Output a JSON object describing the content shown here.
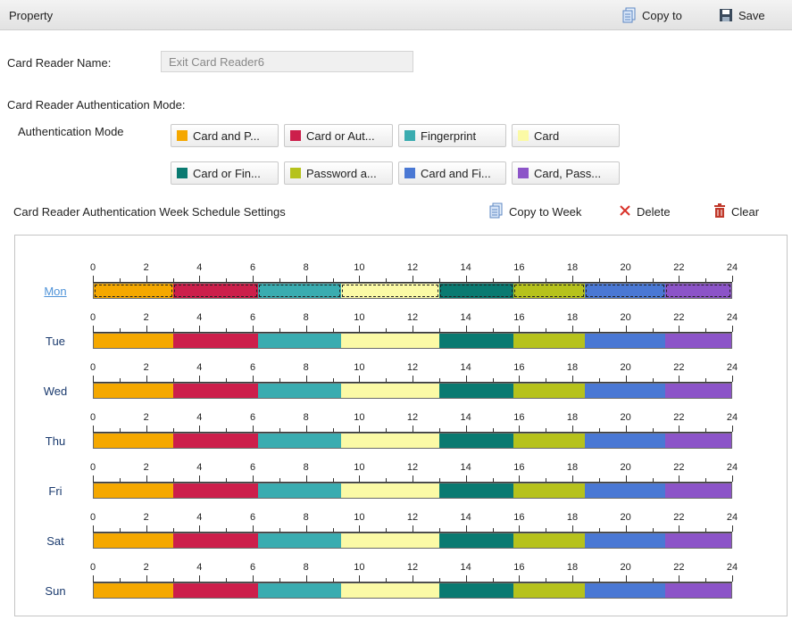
{
  "header": {
    "title": "Property",
    "copy_to_label": "Copy to",
    "save_label": "Save"
  },
  "card_reader_name": {
    "label": "Card Reader Name:",
    "value": "Exit Card Reader6"
  },
  "auth_mode_section": {
    "title": "Card Reader Authentication Mode:",
    "mode_label": "Authentication Mode"
  },
  "modes": [
    {
      "label": "Card and P...",
      "color": "#f5a800"
    },
    {
      "label": "Card or Aut...",
      "color": "#cc1f4b"
    },
    {
      "label": "Fingerprint",
      "color": "#3aacb0"
    },
    {
      "label": "Card",
      "color": "#fbfaa6"
    },
    {
      "label": "Card or Fin...",
      "color": "#0a7a71"
    },
    {
      "label": "Password a...",
      "color": "#b6c21c"
    },
    {
      "label": "Card and Fi...",
      "color": "#4a78d4"
    },
    {
      "label": "Card, Pass...",
      "color": "#8c54c8"
    }
  ],
  "schedule": {
    "title": "Card Reader Authentication Week Schedule Settings",
    "copy_to_week_label": "Copy to Week",
    "delete_label": "Delete",
    "clear_label": "Clear",
    "hours": [
      "0",
      "2",
      "4",
      "6",
      "8",
      "10",
      "12",
      "14",
      "16",
      "18",
      "20",
      "22",
      "24"
    ],
    "segments_hours": [
      {
        "start": 0,
        "end": 3,
        "mode": 0
      },
      {
        "start": 3,
        "end": 6.2,
        "mode": 1
      },
      {
        "start": 6.2,
        "end": 9.3,
        "mode": 2
      },
      {
        "start": 9.3,
        "end": 13,
        "mode": 3
      },
      {
        "start": 13,
        "end": 15.8,
        "mode": 4
      },
      {
        "start": 15.8,
        "end": 18.5,
        "mode": 5
      },
      {
        "start": 18.5,
        "end": 21.5,
        "mode": 6
      },
      {
        "start": 21.5,
        "end": 24,
        "mode": 7
      }
    ],
    "days": [
      {
        "label": "Mon",
        "selected": true
      },
      {
        "label": "Tue",
        "selected": false
      },
      {
        "label": "Wed",
        "selected": false
      },
      {
        "label": "Thu",
        "selected": false
      },
      {
        "label": "Fri",
        "selected": false
      },
      {
        "label": "Sat",
        "selected": false
      },
      {
        "label": "Sun",
        "selected": false
      }
    ]
  }
}
